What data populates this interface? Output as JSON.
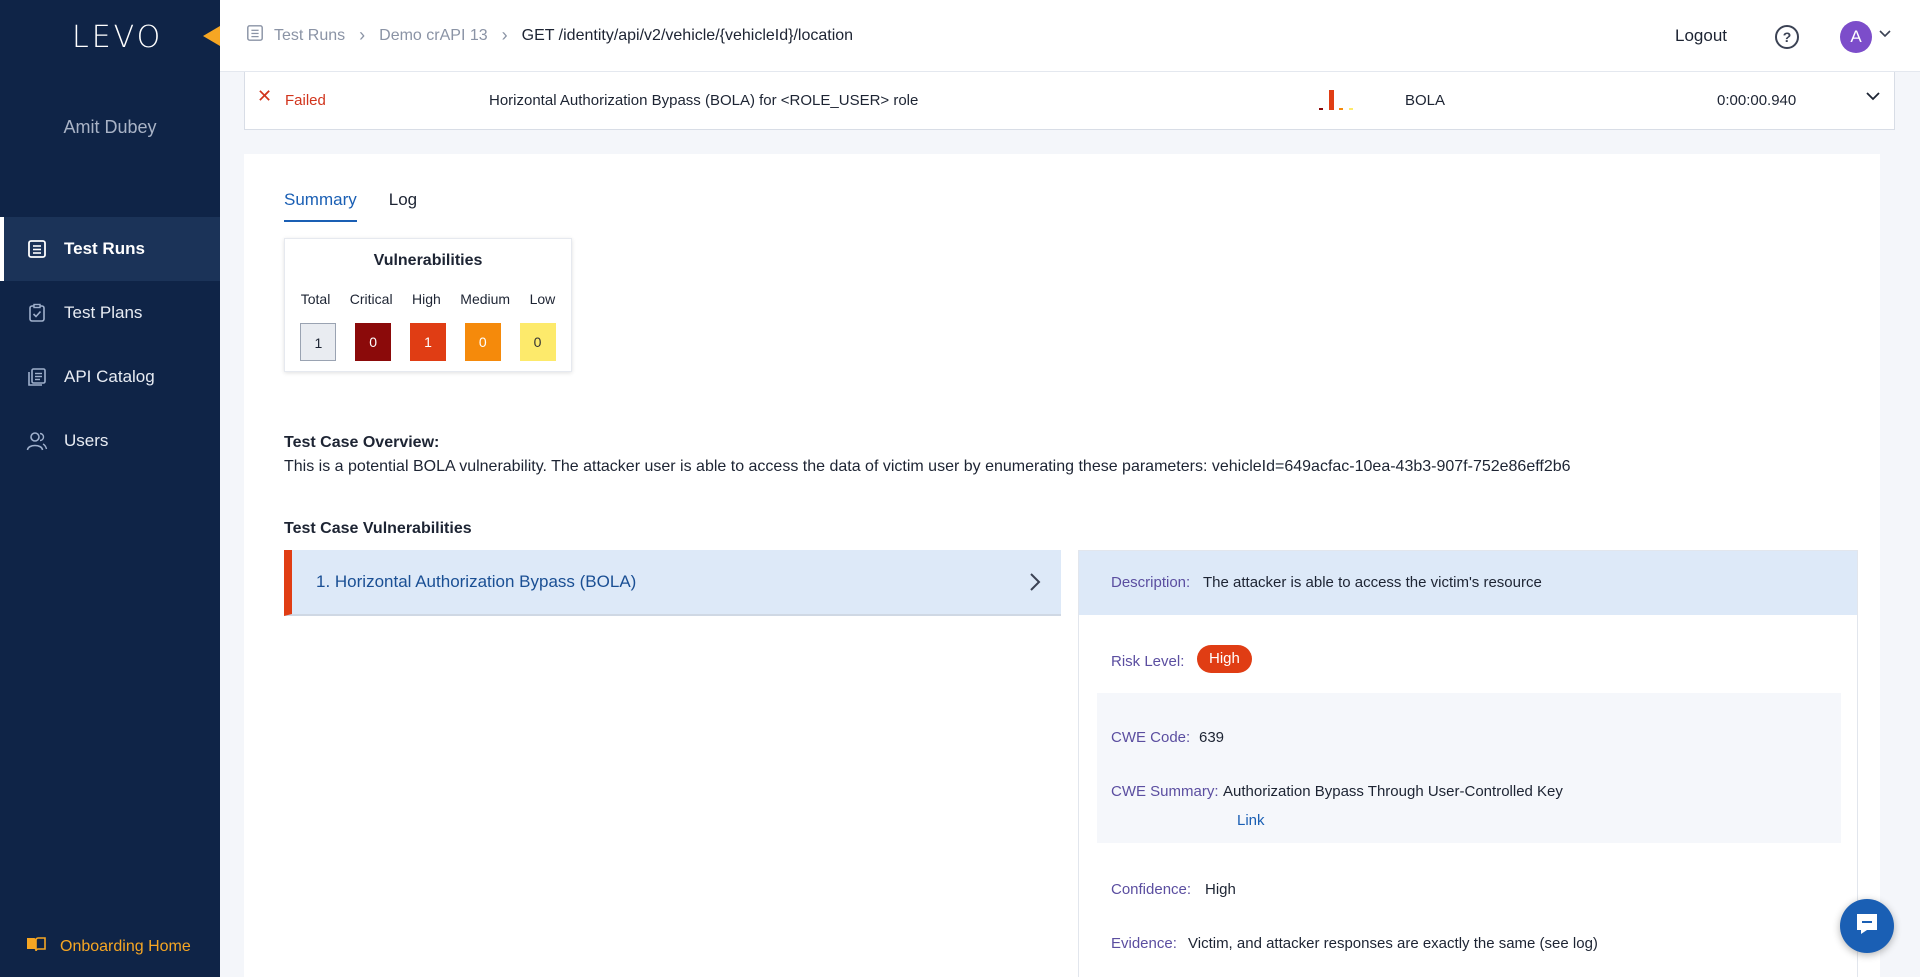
{
  "app": {
    "logo_text": "LEVO",
    "accent_color": "#f6a623",
    "sidebar_bg": "#0f2447"
  },
  "sidebar": {
    "user_name": "Amit Dubey",
    "items": [
      {
        "label": "Test Runs",
        "icon": "list-icon",
        "active": true
      },
      {
        "label": "Test Plans",
        "icon": "clipboard-check-icon",
        "active": false
      },
      {
        "label": "API Catalog",
        "icon": "catalog-icon",
        "active": false
      },
      {
        "label": "Users",
        "icon": "users-icon",
        "active": false
      }
    ],
    "onboarding_label": "Onboarding Home"
  },
  "header": {
    "breadcrumbs": [
      "Test Runs",
      "Demo crAPI 13",
      "GET /identity/api/v2/vehicle/{vehicleId}/location"
    ],
    "logout_label": "Logout",
    "help_icon": "question-circle-icon",
    "avatar_initial": "A"
  },
  "result_row": {
    "status": "Failed",
    "title": "Horizontal Authorization Bypass (BOLA) for <ROLE_USER> role",
    "category": "BOLA",
    "duration": "0:00:00.940"
  },
  "tabs": [
    {
      "label": "Summary",
      "active": true
    },
    {
      "label": "Log",
      "active": false
    }
  ],
  "vulnerabilities": {
    "title": "Vulnerabilities",
    "labels": [
      "Total",
      "Critical",
      "High",
      "Medium",
      "Low"
    ],
    "counts": [
      "1",
      "0",
      "1",
      "0",
      "0"
    ],
    "colors": {
      "critical": "#8b0a0a",
      "high": "#e03d14",
      "medium": "#f58a0b",
      "low": "#fdea6b"
    }
  },
  "overview": {
    "label": "Test Case Overview:",
    "text": "This is a potential BOLA vulnerability. The attacker user is able to access the data of victim user by enumerating these parameters: vehicleId=649acfac-10ea-43b3-907f-752e86eff2b6"
  },
  "test_case_vulns": {
    "label": "Test Case Vulnerabilities",
    "items": [
      {
        "label": "1. Horizontal Authorization Bypass (BOLA)"
      }
    ]
  },
  "detail": {
    "description_key": "Description:",
    "description_val": "The attacker is able to access the victim's resource",
    "risk_key": "Risk Level:",
    "risk_val": "High",
    "cwe_code_key": "CWE Code:",
    "cwe_code_val": "639",
    "cwe_summary_key": "CWE Summary:",
    "cwe_summary_val": "Authorization Bypass Through User-Controlled Key",
    "cwe_link": "Link",
    "confidence_key": "Confidence:",
    "confidence_val": "High",
    "evidence_key": "Evidence:",
    "evidence_val": "Victim, and attacker responses are exactly the same (see log)"
  }
}
